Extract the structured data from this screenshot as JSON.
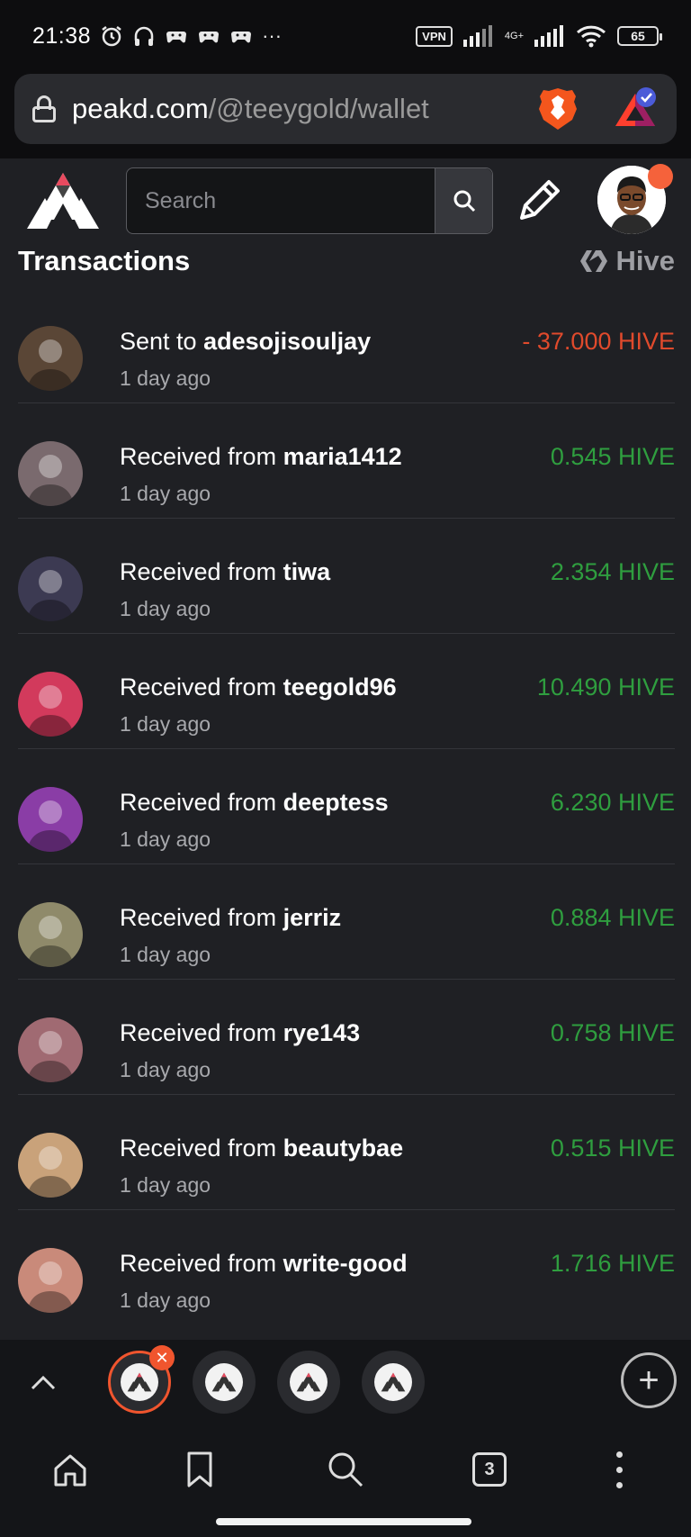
{
  "status_bar": {
    "time": "21:38",
    "icons": [
      "alarm-icon",
      "headphones-icon",
      "game-icon",
      "game-icon",
      "game-icon",
      "more-icon"
    ],
    "more": "···",
    "vpn": "VPN",
    "network": "4G+",
    "battery": "65"
  },
  "address_bar": {
    "domain": "peakd.com",
    "path": "/@teeygold/wallet"
  },
  "site_header": {
    "search_placeholder": "Search"
  },
  "transactions": {
    "title": "Transactions",
    "token": "Hive",
    "items": [
      {
        "prefix": "Sent to ",
        "user": "adesojisouljay",
        "time": "1 day ago",
        "amount": "- 37.000 HIVE",
        "direction": "out",
        "avatar_color": "#5a4636"
      },
      {
        "prefix": "Received from ",
        "user": "maria1412",
        "time": "1 day ago",
        "amount": "0.545 HIVE",
        "direction": "in",
        "avatar_color": "#7a6a6e"
      },
      {
        "prefix": "Received from ",
        "user": "tiwa",
        "time": "1 day ago",
        "amount": "2.354 HIVE",
        "direction": "in",
        "avatar_color": "#3c3a52"
      },
      {
        "prefix": "Received from ",
        "user": "teegold96",
        "time": "1 day ago",
        "amount": "10.490 HIVE",
        "direction": "in",
        "avatar_color": "#d23a5c"
      },
      {
        "prefix": "Received from ",
        "user": "deeptess",
        "time": "1 day ago",
        "amount": "6.230 HIVE",
        "direction": "in",
        "avatar_color": "#8a3da6"
      },
      {
        "prefix": "Received from ",
        "user": "jerriz",
        "time": "1 day ago",
        "amount": "0.884 HIVE",
        "direction": "in",
        "avatar_color": "#8f8a6a"
      },
      {
        "prefix": "Received from ",
        "user": "rye143",
        "time": "1 day ago",
        "amount": "0.758 HIVE",
        "direction": "in",
        "avatar_color": "#a06a72"
      },
      {
        "prefix": "Received from ",
        "user": "beautybae",
        "time": "1 day ago",
        "amount": "0.515 HIVE",
        "direction": "in",
        "avatar_color": "#c9a27a"
      },
      {
        "prefix": "Received from ",
        "user": "write-good",
        "time": "1 day ago",
        "amount": "1.716 HIVE",
        "direction": "in",
        "avatar_color": "#c98a7a"
      }
    ]
  },
  "tab_strip": {
    "tab_count_label": "3",
    "new_tab": "+"
  },
  "colors": {
    "accent": "#f0552e",
    "positive": "#2f9e3f",
    "negative": "#e04a2c",
    "background": "#1f2024"
  }
}
